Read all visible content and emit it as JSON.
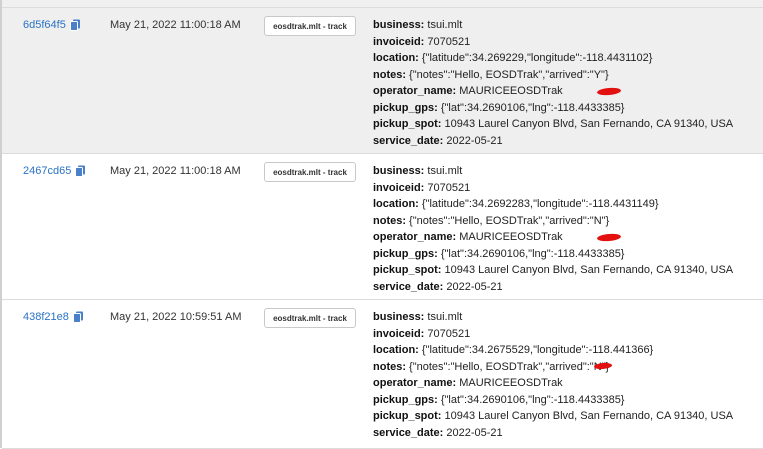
{
  "records": [
    {
      "id": "6d5f64f5",
      "date": "May 21, 2022 11:00:18 AM",
      "tag": "eosdtrak.mlt - track",
      "fields": [
        {
          "key": "business:",
          "value": " tsui.mlt"
        },
        {
          "key": "invoiceid:",
          "value": " 7070521"
        },
        {
          "key": "location:",
          "value": " {\"latitude\":34.269229,\"longitude\":-118.4431102}"
        },
        {
          "key": "notes:",
          "value": " {\"notes\":\"Hello, EOSDTrak\",\"arrived\":\"Y\"}"
        },
        {
          "key": "operator_name:",
          "value": " MAURICEEOSDTrak"
        },
        {
          "key": "pickup_gps:",
          "value": " {\"lat\":34.2690106,\"lng\":-118.4433385}"
        },
        {
          "key": "pickup_spot:",
          "value": " 10943 Laurel Canyon Blvd, San Fernando, CA 91340, USA"
        },
        {
          "key": "service_date:",
          "value": " 2022-05-21"
        }
      ]
    },
    {
      "id": "2467cd65",
      "date": "May 21, 2022 11:00:18 AM",
      "tag": "eosdtrak.mlt - track",
      "fields": [
        {
          "key": "business:",
          "value": " tsui.mlt"
        },
        {
          "key": "invoiceid:",
          "value": " 7070521"
        },
        {
          "key": "location:",
          "value": " {\"latitude\":34.2692283,\"longitude\":-118.4431149}"
        },
        {
          "key": "notes:",
          "value": " {\"notes\":\"Hello, EOSDTrak\",\"arrived\":\"N\"}"
        },
        {
          "key": "operator_name:",
          "value": " MAURICEEOSDTrak"
        },
        {
          "key": "pickup_gps:",
          "value": " {\"lat\":34.2690106,\"lng\":-118.4433385}"
        },
        {
          "key": "pickup_spot:",
          "value": " 10943 Laurel Canyon Blvd, San Fernando, CA 91340, USA"
        },
        {
          "key": "service_date:",
          "value": " 2022-05-21"
        }
      ]
    },
    {
      "id": "438f21e8",
      "date": "May 21, 2022 10:59:51 AM",
      "tag": "eosdtrak.mlt - track",
      "fields": [
        {
          "key": "business:",
          "value": " tsui.mlt"
        },
        {
          "key": "invoiceid:",
          "value": " 7070521"
        },
        {
          "key": "location:",
          "value": " {\"latitude\":34.2675529,\"longitude\":-118.441366}"
        },
        {
          "key": "notes:",
          "value": " {\"notes\":\"Hello, EOSDTrak\",\"arrived\":\"N\"}"
        },
        {
          "key": "operator_name:",
          "value": " MAURICEEOSDTrak"
        },
        {
          "key": "pickup_gps:",
          "value": " {\"lat\":34.2690106,\"lng\":-118.4433385}"
        },
        {
          "key": "pickup_spot:",
          "value": " 10943 Laurel Canyon Blvd, San Fernando, CA 91340, USA"
        },
        {
          "key": "service_date:",
          "value": " 2022-05-21"
        }
      ]
    }
  ],
  "colors": {
    "link": "#2a73c5",
    "redaction": "#e31010",
    "row_alt": "#efefef"
  },
  "icons": {
    "copy": "copy-icon"
  }
}
